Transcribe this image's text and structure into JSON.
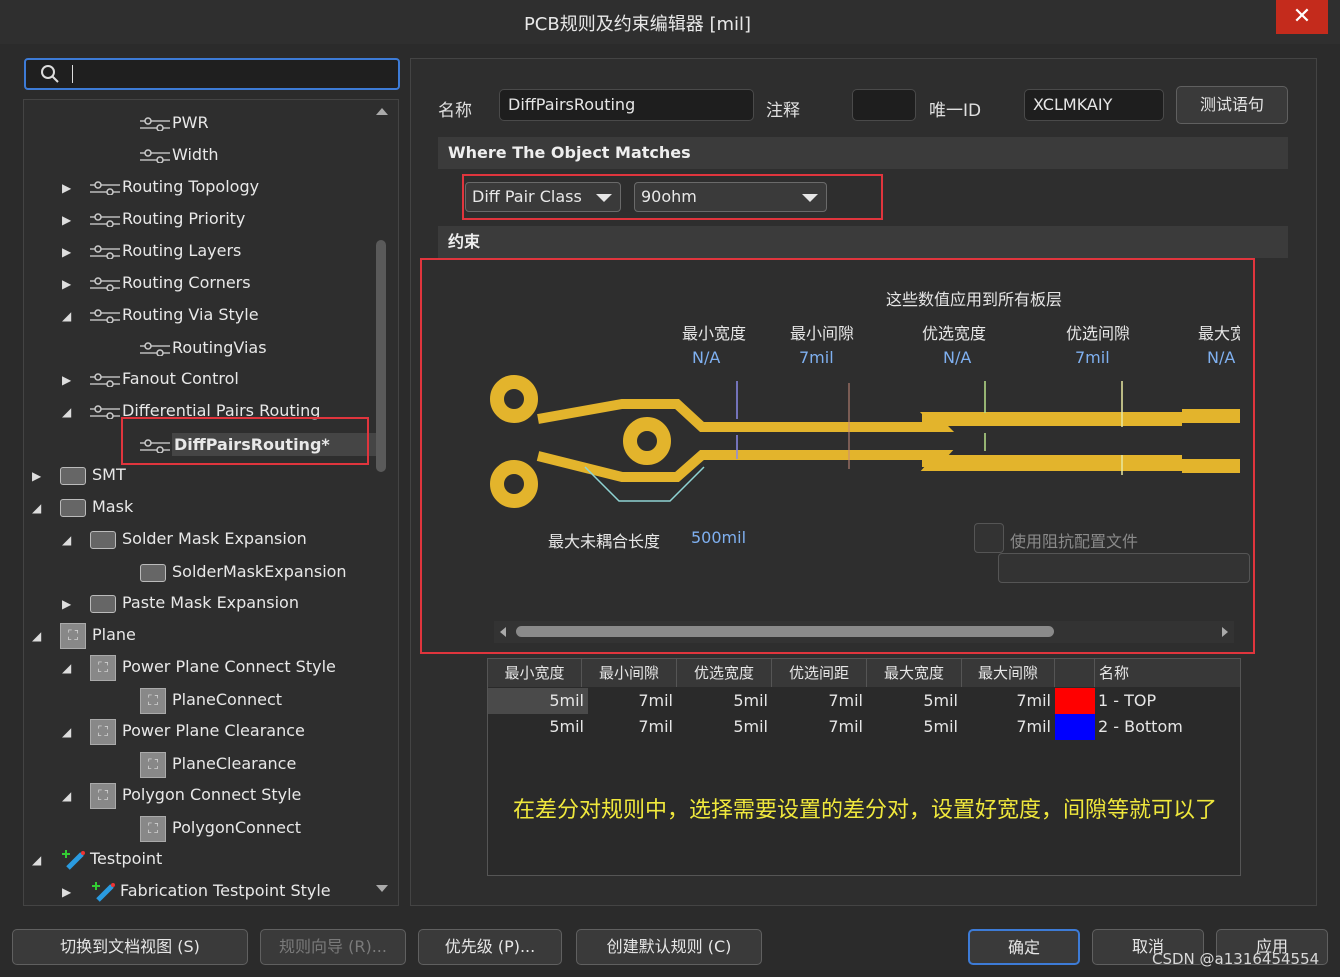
{
  "window": {
    "title": "PCB规则及约束编辑器 [mil]",
    "close_label": "✕"
  },
  "search": {
    "placeholder": ""
  },
  "tree": [
    {
      "label": "PWR",
      "icon": "rule-icon"
    },
    {
      "label": "Width",
      "icon": "rule-icon"
    },
    {
      "label": "Routing Topology",
      "icon": "rule-icon",
      "expander": "collapsed"
    },
    {
      "label": "Routing Priority",
      "icon": "rule-icon",
      "expander": "collapsed"
    },
    {
      "label": "Routing Layers",
      "icon": "rule-icon",
      "expander": "collapsed"
    },
    {
      "label": "Routing Corners",
      "icon": "rule-icon",
      "expander": "collapsed"
    },
    {
      "label": "Routing Via Style",
      "icon": "rule-icon",
      "expander": "expanded"
    },
    {
      "label": "RoutingVias",
      "icon": "rule-icon"
    },
    {
      "label": "Fanout Control",
      "icon": "rule-icon",
      "expander": "collapsed"
    },
    {
      "label": "Differential Pairs Routing",
      "icon": "rule-icon",
      "expander": "expanded"
    },
    {
      "label": "DiffPairsRouting*",
      "icon": "rule-icon",
      "selected": true
    },
    {
      "label": "SMT",
      "icon": "smt-icon",
      "expander": "collapsed"
    },
    {
      "label": "Mask",
      "icon": "mask-icon",
      "expander": "expanded"
    },
    {
      "label": "Solder Mask Expansion",
      "icon": "mask-icon",
      "expander": "expanded"
    },
    {
      "label": "SolderMaskExpansion",
      "icon": "mask-icon"
    },
    {
      "label": "Paste Mask Expansion",
      "icon": "mask-icon",
      "expander": "collapsed"
    },
    {
      "label": "Plane",
      "icon": "plane-icon",
      "expander": "expanded"
    },
    {
      "label": "Power Plane Connect Style",
      "icon": "plane-icon",
      "expander": "expanded"
    },
    {
      "label": "PlaneConnect",
      "icon": "plane-icon"
    },
    {
      "label": "Power Plane Clearance",
      "icon": "plane-icon",
      "expander": "expanded"
    },
    {
      "label": "PlaneClearance",
      "icon": "plane-icon"
    },
    {
      "label": "Polygon Connect Style",
      "icon": "plane-icon",
      "expander": "expanded"
    },
    {
      "label": "PolygonConnect",
      "icon": "plane-icon"
    },
    {
      "label": "Testpoint",
      "icon": "testpoint-icon",
      "expander": "expanded"
    },
    {
      "label": "Fabrication Testpoint Style",
      "icon": "testpoint-icon",
      "expander": "collapsed"
    }
  ],
  "rule": {
    "name_label": "名称",
    "name_value": "DiffPairsRouting",
    "comment_label": "注释",
    "comment_value": "",
    "uid_label": "唯一ID",
    "uid_value": "XCLMKAIY",
    "test_button": "测试语句"
  },
  "match": {
    "header": "Where The Object Matches",
    "type_value": "Diff Pair Class",
    "class_value": "90ohm"
  },
  "constraints": {
    "header": "约束",
    "all_layers_note": "这些数值应用到所有板层",
    "columns": [
      {
        "label": "最小宽度",
        "value": "N/A"
      },
      {
        "label": "最小间隙",
        "value": "7mil"
      },
      {
        "label": "优选宽度",
        "value": "N/A"
      },
      {
        "label": "优选间隙",
        "value": "7mil"
      },
      {
        "label": "最大宽",
        "value": "N/A"
      }
    ],
    "uncoupled_label": "最大未耦合长度",
    "uncoupled_value": "500mil",
    "impedance_label": "使用阻抗配置文件"
  },
  "layer_table": {
    "headers": [
      "最小宽度",
      "最小间隙",
      "优选宽度",
      "优选间距",
      "最大宽度",
      "最大间隙",
      "",
      "名称"
    ],
    "rows": [
      {
        "values": [
          "5mil",
          "7mil",
          "5mil",
          "7mil",
          "5mil",
          "7mil"
        ],
        "color": "#ff0000",
        "name": "1 - TOP"
      },
      {
        "values": [
          "5mil",
          "7mil",
          "5mil",
          "7mil",
          "5mil",
          "7mil"
        ],
        "color": "#0000ff",
        "name": "2 - Bottom"
      }
    ]
  },
  "annotation": "在差分对规则中，选择需要设置的差分对，设置好宽度，间隙等就可以了",
  "buttons": {
    "switch_view": "切换到文档视图 (S)",
    "wizard": "规则向导 (R)...",
    "priority": "优先级 (P)...",
    "create_default": "创建默认规则 (C)",
    "ok": "确定",
    "cancel": "取消",
    "apply": "应用"
  },
  "watermark": "CSDN @a1316454554",
  "colors": {
    "accent": "#3d7bd6",
    "highlight_box": "#e0353d",
    "trace": "#e3b42c",
    "value_text": "#7fb0f0",
    "note_text": "#f0e83c"
  }
}
